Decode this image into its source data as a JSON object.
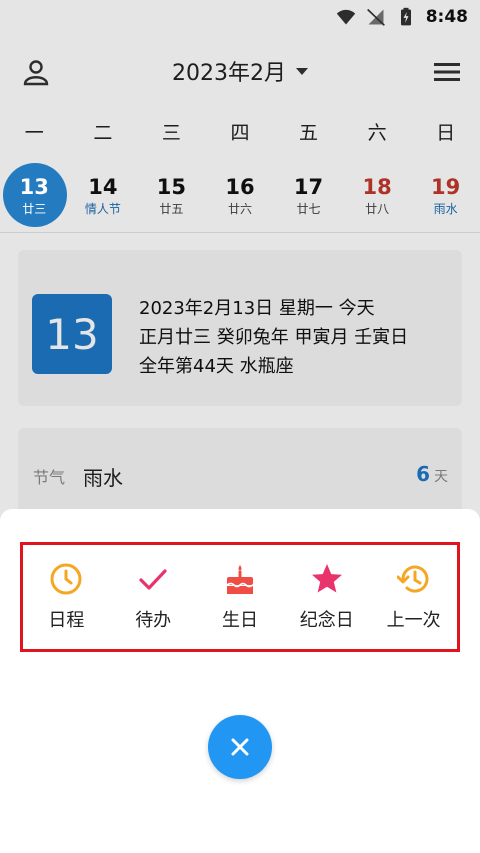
{
  "status_bar": {
    "time": "8:48"
  },
  "header": {
    "title": "2023年2月"
  },
  "weekdays": [
    "一",
    "二",
    "三",
    "四",
    "五",
    "六",
    "日"
  ],
  "dates": [
    {
      "day": "13",
      "sub": "廿三"
    },
    {
      "day": "14",
      "sub": "情人节"
    },
    {
      "day": "15",
      "sub": "廿五"
    },
    {
      "day": "16",
      "sub": "廿六"
    },
    {
      "day": "17",
      "sub": "廿七"
    },
    {
      "day": "18",
      "sub": "廿八"
    },
    {
      "day": "19",
      "sub": "雨水"
    }
  ],
  "today_card": {
    "day": "13",
    "line1": "2023年2月13日 星期一 今天",
    "line2": "正月廿三 癸卯兔年 甲寅月 壬寅日",
    "line3": "全年第44天 水瓶座"
  },
  "solar_term": {
    "label": "节气",
    "name": "雨水",
    "days": "6",
    "unit": "天"
  },
  "actions": [
    {
      "label": "日程",
      "icon": "clock-icon",
      "color": "#f5a623"
    },
    {
      "label": "待办",
      "icon": "check-icon",
      "color": "#e8336d"
    },
    {
      "label": "生日",
      "icon": "cake-icon",
      "color": "#f04e45"
    },
    {
      "label": "纪念日",
      "icon": "star-icon",
      "color": "#e8336d"
    },
    {
      "label": "上一次",
      "icon": "history-icon",
      "color": "#f5a623"
    }
  ],
  "colors": {
    "accent": "#2196f3",
    "highlight_border": "#e0141e"
  }
}
